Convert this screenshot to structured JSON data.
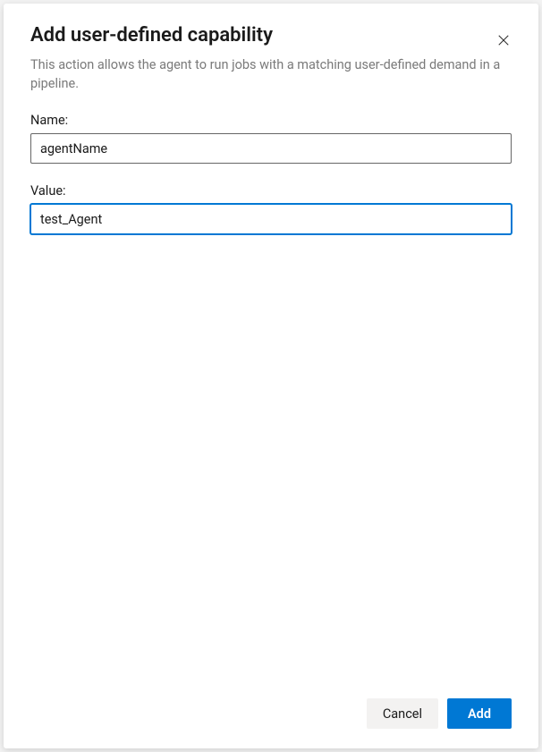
{
  "dialog": {
    "title": "Add user-defined capability",
    "description": "This action allows the agent to run jobs with a matching user-defined demand in a pipeline."
  },
  "form": {
    "name": {
      "label": "Name:",
      "value": "agentName"
    },
    "value": {
      "label": "Value:",
      "value": "test_Agent"
    }
  },
  "footer": {
    "cancel_label": "Cancel",
    "add_label": "Add"
  }
}
